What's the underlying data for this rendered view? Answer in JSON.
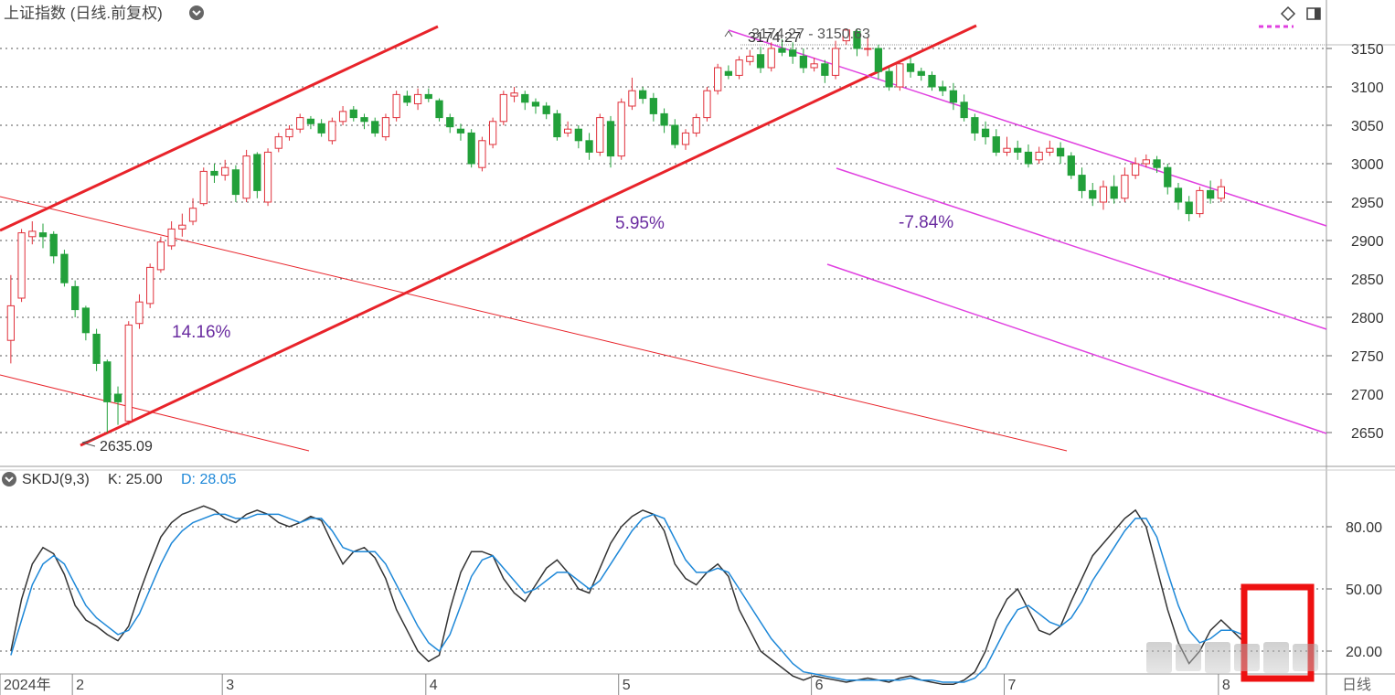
{
  "header": {
    "title": "上证指数 (日线.前复权)",
    "menu_icon": "chevron-down-circle-icon",
    "right_icons": [
      "diamond-icon",
      "panel-toggle-icon"
    ]
  },
  "indicator": {
    "name": "SKDJ(9,3)",
    "k_label": "K: 25.00",
    "d_label": "D: 28.05",
    "k_color": "#333333",
    "d_color": "#1e88d8"
  },
  "colors": {
    "up": "#e0303a",
    "down": "#22a03a",
    "trend_red": "#e8232a",
    "channel_magenta": "#e040e0",
    "label_purple": "#6a2ca0"
  },
  "chart_data": [
    {
      "type": "candlestick",
      "title": "上证指数 (日线.前复权)",
      "xlabel": "",
      "ylabel": "",
      "ylim": [
        2620,
        3170
      ],
      "y_ticks": [
        2650,
        2700,
        2750,
        2800,
        2850,
        2900,
        2950,
        3000,
        3050,
        3100,
        3150
      ],
      "x_tick_labels": [
        "2024年",
        "2",
        "3",
        "4",
        "5",
        "6",
        "7",
        "8",
        "日线"
      ],
      "x_tick_days": [
        0,
        6,
        20,
        39,
        57,
        75,
        93,
        113
      ],
      "days_count": 120,
      "candles": [
        [
          2770,
          2815,
          2740,
          2855
        ],
        [
          2825,
          2910,
          2820,
          2915
        ],
        [
          2905,
          2912,
          2895,
          2925
        ],
        [
          2910,
          2905,
          2890,
          2922
        ],
        [
          2908,
          2880,
          2870,
          2912
        ],
        [
          2882,
          2845,
          2840,
          2888
        ],
        [
          2840,
          2810,
          2800,
          2848
        ],
        [
          2812,
          2780,
          2770,
          2815
        ],
        [
          2778,
          2740,
          2730,
          2785
        ],
        [
          2742,
          2690,
          2650,
          2745
        ],
        [
          2700,
          2690,
          2660,
          2710
        ],
        [
          2665,
          2790,
          2660,
          2795
        ],
        [
          2792,
          2820,
          2785,
          2830
        ],
        [
          2818,
          2865,
          2812,
          2870
        ],
        [
          2862,
          2898,
          2858,
          2905
        ],
        [
          2893,
          2915,
          2888,
          2925
        ],
        [
          2915,
          2920,
          2905,
          2935
        ],
        [
          2925,
          2942,
          2920,
          2955
        ],
        [
          2948,
          2990,
          2945,
          2995
        ],
        [
          2990,
          2985,
          2975,
          3000
        ],
        [
          2985,
          2995,
          2978,
          3005
        ],
        [
          2992,
          2960,
          2950,
          2998
        ],
        [
          2955,
          3010,
          2950,
          3018
        ],
        [
          3012,
          2965,
          2955,
          3015
        ],
        [
          2950,
          3015,
          2945,
          3020
        ],
        [
          3020,
          3035,
          3015,
          3040
        ],
        [
          3035,
          3045,
          3030,
          3050
        ],
        [
          3045,
          3060,
          3040,
          3065
        ],
        [
          3058,
          3052,
          3045,
          3062
        ],
        [
          3052,
          3040,
          3035,
          3058
        ],
        [
          3030,
          3055,
          3025,
          3060
        ],
        [
          3055,
          3068,
          3050,
          3075
        ],
        [
          3070,
          3060,
          3055,
          3075
        ],
        [
          3060,
          3055,
          3045,
          3065
        ],
        [
          3055,
          3040,
          3035,
          3060
        ],
        [
          3035,
          3060,
          3030,
          3065
        ],
        [
          3060,
          3090,
          3055,
          3095
        ],
        [
          3088,
          3080,
          3075,
          3095
        ],
        [
          3078,
          3090,
          3070,
          3098
        ],
        [
          3090,
          3085,
          3080,
          3098
        ],
        [
          3082,
          3060,
          3055,
          3085
        ],
        [
          3060,
          3048,
          3040,
          3065
        ],
        [
          3045,
          3040,
          3030,
          3052
        ],
        [
          3040,
          3000,
          2995,
          3045
        ],
        [
          2995,
          3030,
          2990,
          3035
        ],
        [
          3025,
          3055,
          3020,
          3060
        ],
        [
          3055,
          3090,
          3050,
          3095
        ],
        [
          3088,
          3092,
          3080,
          3100
        ],
        [
          3090,
          3080,
          3070,
          3095
        ],
        [
          3080,
          3075,
          3065,
          3085
        ],
        [
          3075,
          3065,
          3058,
          3080
        ],
        [
          3065,
          3035,
          3030,
          3070
        ],
        [
          3040,
          3045,
          3035,
          3055
        ],
        [
          3045,
          3030,
          3020,
          3050
        ],
        [
          3030,
          3015,
          3005,
          3040
        ],
        [
          3015,
          3060,
          3010,
          3065
        ],
        [
          3055,
          3010,
          2995,
          3062
        ],
        [
          3010,
          3080,
          3005,
          3085
        ],
        [
          3075,
          3095,
          3070,
          3112
        ],
        [
          3095,
          3085,
          3078,
          3100
        ],
        [
          3085,
          3065,
          3055,
          3092
        ],
        [
          3065,
          3050,
          3040,
          3072
        ],
        [
          3050,
          3025,
          3020,
          3058
        ],
        [
          3025,
          3040,
          3018,
          3045
        ],
        [
          3040,
          3060,
          3035,
          3065
        ],
        [
          3060,
          3095,
          3055,
          3100
        ],
        [
          3095,
          3125,
          3090,
          3130
        ],
        [
          3120,
          3115,
          3110,
          3128
        ],
        [
          3115,
          3135,
          3110,
          3140
        ],
        [
          3133,
          3140,
          3128,
          3148
        ],
        [
          3142,
          3125,
          3118,
          3152
        ],
        [
          3125,
          3150,
          3120,
          3158
        ],
        [
          3150,
          3145,
          3140,
          3162
        ],
        [
          3148,
          3140,
          3130,
          3158
        ],
        [
          3140,
          3125,
          3118,
          3150
        ],
        [
          3125,
          3130,
          3120,
          3138
        ],
        [
          3130,
          3115,
          3105,
          3135
        ],
        [
          3115,
          3150,
          3110,
          3160
        ],
        [
          3160,
          3174,
          3155,
          3176
        ],
        [
          3172,
          3150,
          3140,
          3176
        ],
        [
          3150,
          3150,
          3140,
          3165
        ],
        [
          3150,
          3120,
          3110,
          3155
        ],
        [
          3120,
          3100,
          3095,
          3125
        ],
        [
          3100,
          3130,
          3095,
          3135
        ],
        [
          3130,
          3120,
          3112,
          3138
        ],
        [
          3120,
          3115,
          3108,
          3125
        ],
        [
          3115,
          3100,
          3095,
          3120
        ],
        [
          3100,
          3095,
          3088,
          3108
        ],
        [
          3095,
          3080,
          3070,
          3105
        ],
        [
          3080,
          3060,
          3055,
          3090
        ],
        [
          3060,
          3040,
          3030,
          3065
        ],
        [
          3045,
          3035,
          3025,
          3055
        ],
        [
          3035,
          3015,
          3010,
          3045
        ],
        [
          3015,
          3020,
          3010,
          3035
        ],
        [
          3020,
          3015,
          3005,
          3030
        ],
        [
          3015,
          3000,
          2995,
          3025
        ],
        [
          3005,
          3015,
          3000,
          3022
        ],
        [
          3015,
          3020,
          3010,
          3030
        ],
        [
          3020,
          3010,
          3000,
          3028
        ],
        [
          3010,
          2985,
          2980,
          3015
        ],
        [
          2985,
          2965,
          2955,
          2995
        ],
        [
          2965,
          2955,
          2945,
          2975
        ],
        [
          2950,
          2970,
          2940,
          2978
        ],
        [
          2970,
          2955,
          2948,
          2985
        ],
        [
          2955,
          2985,
          2950,
          2995
        ],
        [
          2985,
          3000,
          2980,
          3008
        ],
        [
          3000,
          3005,
          2995,
          3012
        ],
        [
          3005,
          2995,
          2988,
          3010
        ],
        [
          2995,
          2970,
          2960,
          3000
        ],
        [
          2968,
          2950,
          2940,
          2975
        ],
        [
          2950,
          2935,
          2925,
          2958
        ],
        [
          2935,
          2965,
          2930,
          2970
        ],
        [
          2965,
          2955,
          2948,
          2978
        ],
        [
          2955,
          2970,
          2950,
          2980
        ]
      ],
      "annotations": [
        {
          "text": "14.16%"
        },
        {
          "text": "5.95%"
        },
        {
          "text": "-7.84%"
        },
        {
          "text": "2635.09"
        },
        {
          "text": "3174.27"
        },
        {
          "text": "3174.27 - 3150.63"
        }
      ],
      "grid": true
    },
    {
      "type": "line",
      "title": "SKDJ(9,3)",
      "ylim": [
        0,
        100
      ],
      "y_ticks": [
        20,
        50,
        80
      ],
      "y_tick_labels": [
        "20.00",
        "50.00",
        "80.00"
      ],
      "series": [
        {
          "name": "K",
          "values": [
            20,
            45,
            62,
            70,
            67,
            57,
            42,
            35,
            32,
            28,
            25,
            32,
            48,
            62,
            75,
            82,
            86,
            88,
            90,
            88,
            84,
            82,
            86,
            88,
            86,
            82,
            80,
            82,
            85,
            83,
            72,
            62,
            68,
            70,
            65,
            55,
            40,
            30,
            20,
            15,
            18,
            40,
            58,
            68,
            68,
            66,
            55,
            48,
            44,
            52,
            60,
            64,
            58,
            50,
            48,
            60,
            72,
            80,
            85,
            88,
            86,
            78,
            62,
            55,
            52,
            58,
            62,
            56,
            40,
            30,
            20,
            16,
            12,
            8,
            6,
            8,
            7,
            6,
            5,
            6,
            7,
            6,
            5,
            7,
            8,
            6,
            5,
            4,
            4,
            6,
            10,
            20,
            35,
            45,
            50,
            40,
            30,
            28,
            32,
            44,
            55,
            66,
            72,
            78,
            84,
            88,
            80,
            60,
            40,
            24,
            14,
            20,
            30,
            35,
            30,
            25
          ]
        },
        {
          "name": "D",
          "values": [
            18,
            35,
            52,
            62,
            66,
            62,
            52,
            42,
            36,
            32,
            28,
            30,
            38,
            50,
            62,
            72,
            78,
            82,
            84,
            86,
            86,
            84,
            84,
            86,
            86,
            86,
            84,
            82,
            84,
            84,
            78,
            70,
            68,
            68,
            68,
            62,
            52,
            42,
            32,
            24,
            20,
            28,
            42,
            56,
            64,
            66,
            60,
            54,
            48,
            50,
            54,
            58,
            58,
            54,
            50,
            54,
            62,
            70,
            78,
            84,
            86,
            84,
            74,
            64,
            58,
            58,
            60,
            58,
            50,
            42,
            34,
            26,
            20,
            14,
            10,
            9,
            8,
            7,
            6,
            6,
            6,
            6,
            6,
            6,
            7,
            6,
            6,
            5,
            5,
            5,
            7,
            12,
            22,
            32,
            40,
            42,
            38,
            34,
            32,
            36,
            44,
            54,
            62,
            70,
            78,
            84,
            84,
            75,
            58,
            42,
            30,
            24,
            26,
            30,
            30,
            28
          ]
        }
      ],
      "grid": true
    }
  ],
  "watermark": {
    "shape": "blurred-text-block"
  }
}
